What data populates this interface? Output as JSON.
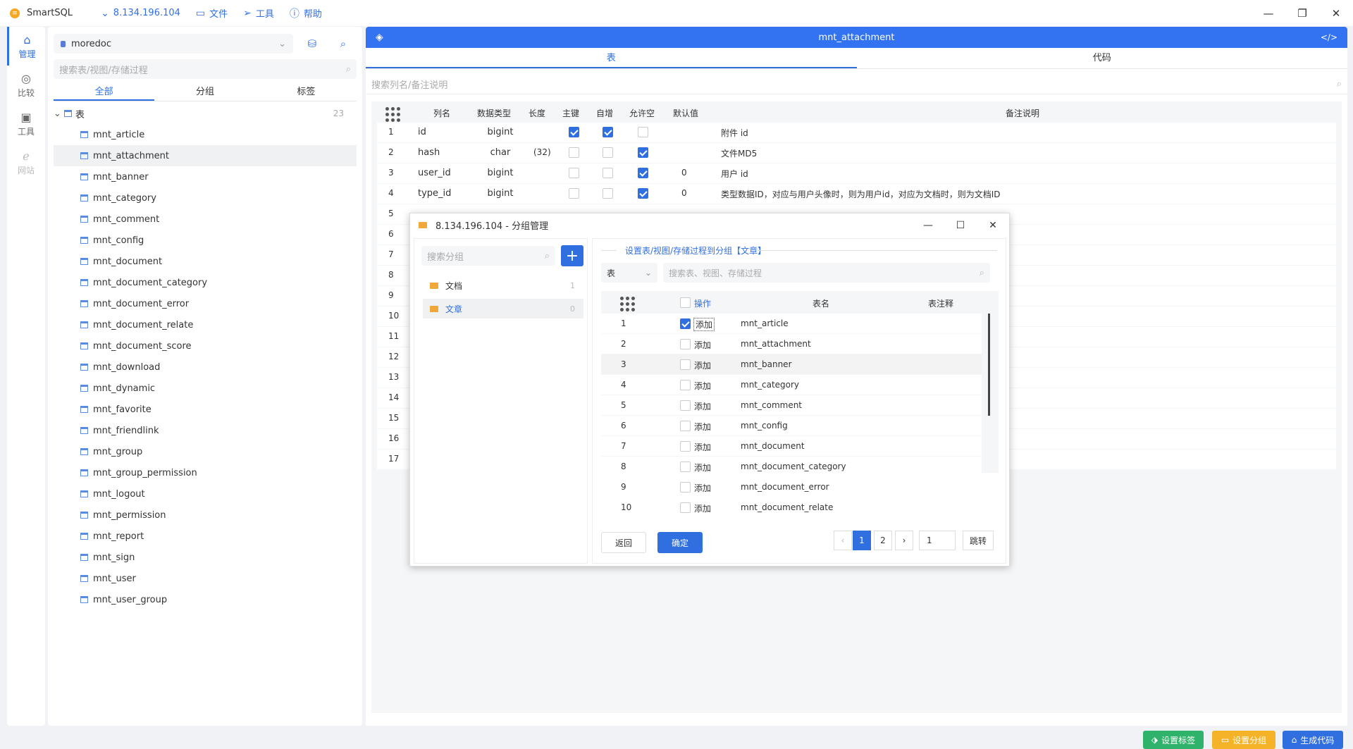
{
  "app": {
    "name": "SmartSQL"
  },
  "menu": {
    "host": "8.134.196.104",
    "file": "文件",
    "tools": "工具",
    "help": "帮助"
  },
  "nav": {
    "manage": "管理",
    "compare": "比较",
    "tools": "工具",
    "website": "网站"
  },
  "db": {
    "name": "moredoc",
    "search_placeholder": "搜索表/视图/存储过程"
  },
  "left_tabs": {
    "all": "全部",
    "group": "分组",
    "tag": "标签"
  },
  "tree": {
    "root": "表",
    "count": "23",
    "items": [
      "mnt_article",
      "mnt_attachment",
      "mnt_banner",
      "mnt_category",
      "mnt_comment",
      "mnt_config",
      "mnt_document",
      "mnt_document_category",
      "mnt_document_error",
      "mnt_document_relate",
      "mnt_document_score",
      "mnt_download",
      "mnt_dynamic",
      "mnt_favorite",
      "mnt_friendlink",
      "mnt_group",
      "mnt_group_permission",
      "mnt_logout",
      "mnt_permission",
      "mnt_report",
      "mnt_sign",
      "mnt_user",
      "mnt_user_group"
    ]
  },
  "main": {
    "title": "mnt_attachment",
    "tab_table": "表",
    "tab_code": "代码",
    "search_placeholder": "搜索列名/备注说明"
  },
  "columns_header": {
    "name": "列名",
    "type": "数据类型",
    "length": "长度",
    "pk": "主键",
    "auto": "自增",
    "nullable": "允许空",
    "default": "默认值",
    "comment": "备注说明"
  },
  "columns": [
    {
      "no": "1",
      "name": "id",
      "type": "bigint",
      "length": "",
      "pk": true,
      "auto": true,
      "nullable": false,
      "default": "",
      "comment": "附件 id"
    },
    {
      "no": "2",
      "name": "hash",
      "type": "char",
      "length": "(32)",
      "pk": false,
      "auto": false,
      "nullable": true,
      "default": "",
      "comment": "文件MD5"
    },
    {
      "no": "3",
      "name": "user_id",
      "type": "bigint",
      "length": "",
      "pk": false,
      "auto": false,
      "nullable": true,
      "default": "0",
      "comment": "用户 id"
    },
    {
      "no": "4",
      "name": "type_id",
      "type": "bigint",
      "length": "",
      "pk": false,
      "auto": false,
      "nullable": true,
      "default": "0",
      "comment": "类型数据ID，对应与用户头像时，则为用户id，对应为文档时，则为文档ID"
    }
  ],
  "row_numbers": [
    "5",
    "6",
    "7",
    "8",
    "9",
    "10",
    "11",
    "12",
    "13",
    "14",
    "15",
    "16",
    "17"
  ],
  "dialog": {
    "title": "8.134.196.104 - 分组管理",
    "group_search_placeholder": "搜索分组",
    "groups": [
      {
        "name": "文档",
        "count": "1"
      },
      {
        "name": "文章",
        "count": "0"
      }
    ],
    "heading": "设置表/视图/存储过程到分组【文章】",
    "type_select": "表",
    "obj_search_placeholder": "搜索表、视图、存储过程",
    "headers": {
      "op": "操作",
      "name": "表名",
      "comment": "表注释"
    },
    "add_label": "添加",
    "rows": [
      {
        "no": "1",
        "name": "mnt_article",
        "checked": true
      },
      {
        "no": "2",
        "name": "mnt_attachment",
        "checked": false
      },
      {
        "no": "3",
        "name": "mnt_banner",
        "checked": false
      },
      {
        "no": "4",
        "name": "mnt_category",
        "checked": false
      },
      {
        "no": "5",
        "name": "mnt_comment",
        "checked": false
      },
      {
        "no": "6",
        "name": "mnt_config",
        "checked": false
      },
      {
        "no": "7",
        "name": "mnt_document",
        "checked": false
      },
      {
        "no": "8",
        "name": "mnt_document_category",
        "checked": false
      },
      {
        "no": "9",
        "name": "mnt_document_error",
        "checked": false
      },
      {
        "no": "10",
        "name": "mnt_document_relate",
        "checked": false
      }
    ],
    "back": "返回",
    "confirm": "确定",
    "pages": [
      "1",
      "2"
    ],
    "page_input": "1",
    "jump": "跳转"
  },
  "bottom": {
    "set_tag": "设置标签",
    "set_group": "设置分组",
    "gen_code": "生成代码"
  },
  "colors": {
    "accent": "#3372f0",
    "green": "#2fb36b",
    "orange": "#f5b32a",
    "blue": "#2f6fe0"
  }
}
